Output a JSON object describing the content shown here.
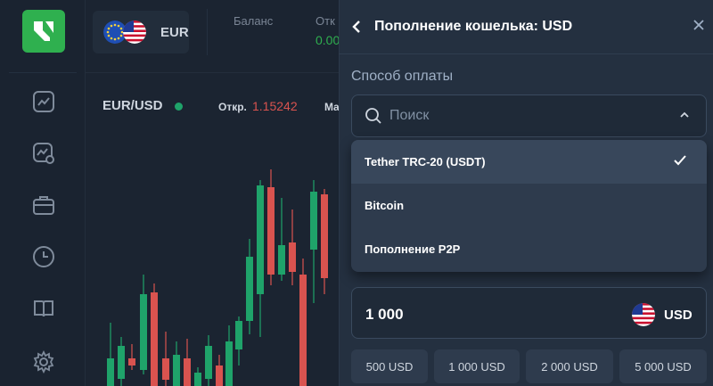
{
  "topbar": {
    "pair_short": "EUR",
    "balance_label": "Баланс",
    "open_label_cut": "Отк",
    "open_value_cut": "0.00"
  },
  "chart": {
    "pair": "EUR/USD",
    "open_label": "Откр.",
    "open_value": "1.15242",
    "next_label_cut": "Ma",
    "up_color": "#1fa36a",
    "down_color": "#d9534f"
  },
  "panel": {
    "title": "Пополнение кошелька: USD",
    "method_label": "Способ оплаты",
    "search_placeholder": "Поиск",
    "options": [
      {
        "label": "Tether TRC-20 (USDT)",
        "selected": true
      },
      {
        "label": "Bitcoin",
        "selected": false
      },
      {
        "label": "Пополнение P2P",
        "selected": false
      }
    ],
    "amount_value": "1 000",
    "amount_currency": "USD",
    "presets": [
      "500 USD",
      "1 000 USD",
      "2 000 USD",
      "5 000 USD"
    ]
  },
  "icons": {
    "rail": [
      "trending-up-icon",
      "chart-settings-icon",
      "briefcase-icon",
      "clock-icon",
      "book-icon",
      "gear-icon"
    ],
    "panel": [
      "chevron-left-icon",
      "close-icon",
      "search-icon",
      "chevron-up-icon",
      "check-icon",
      "us-flag-icon"
    ]
  },
  "colors": {
    "brand_green": "#2fb04f",
    "panel_bg": "#243040",
    "dropdown_bg": "#2e3b4d",
    "selected_bg": "#38475b"
  }
}
